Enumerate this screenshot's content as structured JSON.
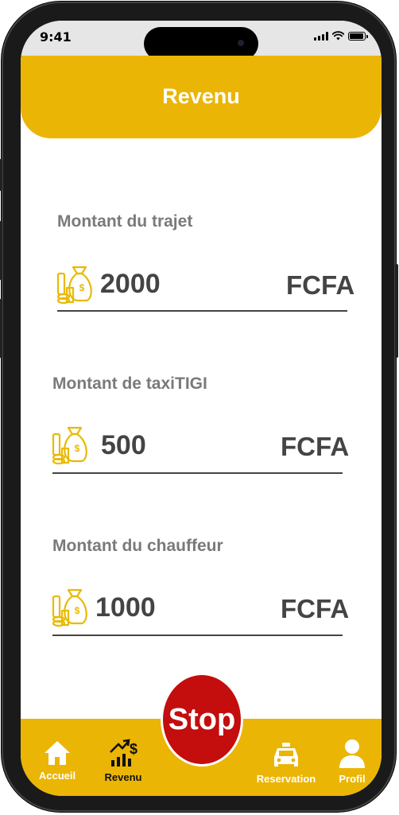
{
  "status_bar": {
    "time": "9:41"
  },
  "header": {
    "title": "Revenu"
  },
  "fields": [
    {
      "label": "Montant du trajet",
      "value": "2000",
      "currency": "FCFA"
    },
    {
      "label": "Montant de taxiTIGI",
      "value": "500",
      "currency": "FCFA"
    },
    {
      "label": "Montant du chauffeur",
      "value": "1000",
      "currency": "FCFA"
    }
  ],
  "stop_button": {
    "label": "Stop"
  },
  "nav": {
    "items": [
      {
        "label": "Accueil",
        "icon": "home-icon"
      },
      {
        "label": "Revenu",
        "icon": "revenue-chart-icon"
      },
      {
        "label": "Reservation",
        "icon": "taxi-icon"
      },
      {
        "label": "Profil",
        "icon": "user-icon"
      }
    ]
  },
  "colors": {
    "accent": "#ebb505",
    "stop": "#c40d0d",
    "text_dark": "#444444",
    "label_gray": "#7a7a7a"
  }
}
